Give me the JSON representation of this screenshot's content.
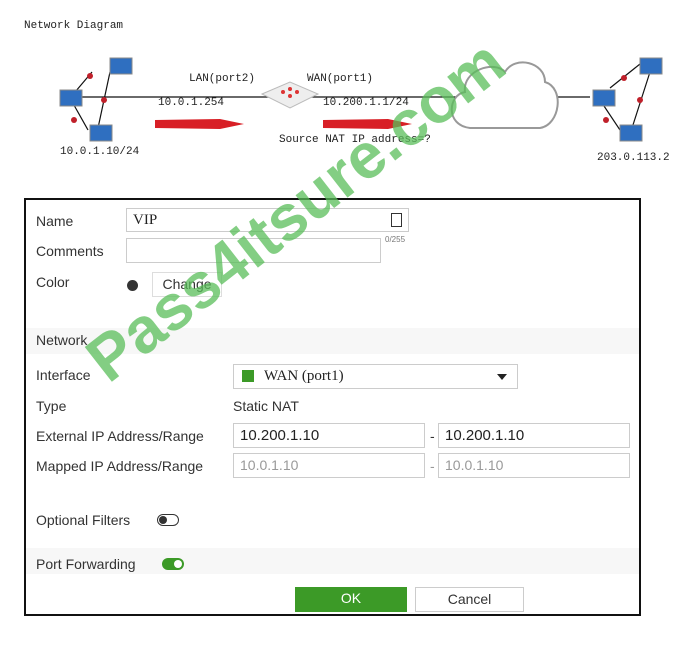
{
  "diagram": {
    "title": "Network Diagram",
    "lan_label": "LAN(port2)",
    "wan_label": "WAN(port1)",
    "lan_ip": "10.0.1.254",
    "wan_ip": "10.200.1.1/24",
    "client_ip": "10.0.1.10/24",
    "remote_ip": "203.0.113.2",
    "question": "Source NAT IP address=?"
  },
  "form": {
    "name_label": "Name",
    "name_value": "VIP",
    "comments_label": "Comments",
    "comments_count": "0/255",
    "color_label": "Color",
    "change_button": "Change",
    "network_heading": "Network",
    "interface_label": "Interface",
    "interface_value": "WAN (port1)",
    "type_label": "Type",
    "type_value": "Static NAT",
    "external_label": "External IP Address/Range",
    "external_start": "10.200.1.10",
    "external_end": "10.200.1.10",
    "mapped_label": "Mapped IP Address/Range",
    "mapped_start": "10.0.1.10",
    "mapped_end": "10.0.1.10",
    "optional_filters_label": "Optional Filters",
    "optional_filters_on": false,
    "port_forwarding_label": "Port Forwarding",
    "port_forwarding_on": true,
    "ok_button": "OK",
    "cancel_button": "Cancel",
    "accent": "#3c9a27"
  },
  "watermark": "Pass4itsure.com"
}
